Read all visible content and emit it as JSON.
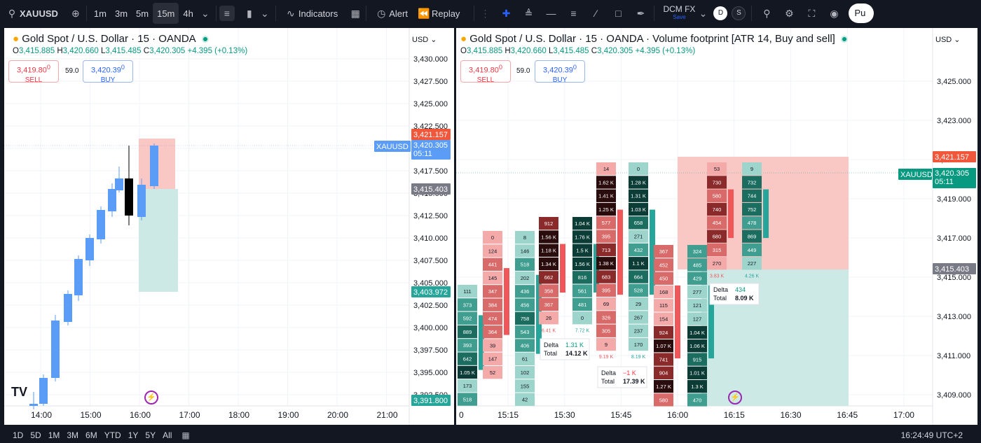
{
  "toolbar": {
    "symbol": "XAUUSD",
    "intervals": [
      "1m",
      "3m",
      "5m",
      "15m",
      "4h"
    ],
    "active_interval": "15m",
    "indicators": "Indicators",
    "alert": "Alert",
    "replay": "Replay",
    "broker": "DCM FX",
    "broker_sub": "Save",
    "avatars": [
      "D",
      "S"
    ],
    "publish": "Pu",
    "icons": [
      "search-icon",
      "plus-circle-icon",
      "bar-style-icon",
      "candles-icon",
      "chevron-down-icon",
      "indicators-icon",
      "layout-icon",
      "alert-clock-icon",
      "replay-icon",
      "crosshair-icon",
      "trend-lines-icon",
      "fib-icon",
      "pattern-icon",
      "brush-icon",
      "shape-icon",
      "text-icon",
      "magnifier-icon",
      "settings-icon",
      "fullscreen-icon",
      "camera-icon"
    ]
  },
  "left": {
    "title": "Gold Spot / U.S. Dollar · 15 · OANDA",
    "ohlc": {
      "o_label": "O",
      "o": "3,415.885",
      "h_label": "H",
      "h": "3,420.660",
      "l_label": "L",
      "l": "3,415.485",
      "c_label": "C",
      "c": "3,420.305",
      "chg": "+4.395 (+0.13%)"
    },
    "sell_price": "3,419.80",
    "sell_sup": "0",
    "sell_label": "SELL",
    "spread": "59.0",
    "buy_price": "3,420.39",
    "buy_sup": "0",
    "buy_label": "BUY",
    "currency": "USD",
    "y_ticks": [
      "3,430.000",
      "3,427.500",
      "3,425.000",
      "3,422.500",
      "3,420.000",
      "3,417.500",
      "3,415.000",
      "3,412.500",
      "3,410.000",
      "3,407.500",
      "3,405.000",
      "3,402.500",
      "3,400.000",
      "3,397.500",
      "3,395.000",
      "3,392.500"
    ],
    "x_ticks": [
      "14:00",
      "15:00",
      "16:00",
      "17:00",
      "18:00",
      "19:00",
      "20:00",
      "21:00"
    ],
    "tags": {
      "target": "3,421.157",
      "symbol": "XAUUSD",
      "last": "3,420.305",
      "countdown": "05:11",
      "entry": "3,415.403",
      "stop": "3,403.972",
      "low": "3,391.800"
    }
  },
  "right": {
    "title": "Gold Spot / U.S. Dollar · 15 · OANDA · Volume footprint [ATR 14, Buy and sell]",
    "ohlc": {
      "o_label": "O",
      "o": "3,415.885",
      "h_label": "H",
      "h": "3,420.660",
      "l_label": "L",
      "l": "3,415.485",
      "c_label": "C",
      "c": "3,420.305",
      "chg": "+4.395 (+0.13%)"
    },
    "sell_price": "3,419.80",
    "sell_sup": "0",
    "sell_label": "SELL",
    "spread": "59.0",
    "buy_price": "3,420.39",
    "buy_sup": "0",
    "buy_label": "BUY",
    "currency": "USD",
    "y_ticks": [
      "3,425.000",
      "3,423.000",
      "3,421.000",
      "3,419.000",
      "3,417.000",
      "3,415.000",
      "3,413.000",
      "3,411.000",
      "3,409.000"
    ],
    "x_ticks": [
      "0",
      "15:15",
      "15:30",
      "15:45",
      "16:00",
      "16:15",
      "16:30",
      "16:45",
      "17:00"
    ],
    "tags": {
      "target": "3,421.157",
      "symbol": "XAUUSD",
      "last": "3,420.305",
      "countdown": "05:11",
      "entry": "3,415.403"
    },
    "footprint": [
      {
        "sell": [
          null,
          null,
          null,
          null,
          null,
          "111",
          "373",
          "592",
          "889",
          "393",
          "642",
          "1.05 K",
          "173",
          "518"
        ],
        "buy": []
      },
      {
        "sell": [],
        "buy": [
          "0",
          "124",
          "441",
          "145",
          "347",
          "384",
          "474",
          "364",
          "39",
          "147",
          "52"
        ]
      },
      {
        "sell": [
          "8",
          "146",
          "518",
          "202",
          "436",
          "456",
          "758",
          "543",
          "406",
          "61",
          "102",
          "155",
          "42"
        ],
        "buy": []
      },
      {
        "sell": [
          "912",
          "1.56 K",
          "1.18 K",
          "1.34 K",
          "662",
          "358",
          "367",
          "26"
        ],
        "buy": [],
        "sub": "6.41 K"
      },
      {
        "sell": [
          "1.04 K",
          "1.76 K",
          "1.5 K",
          "1.56 K",
          "816",
          "561",
          "481",
          "0"
        ],
        "buy": [],
        "sub": "7.72 K"
      },
      {
        "sell": [
          "14",
          "1.62 K",
          "1.41 K",
          "1.25 K",
          "577",
          "395",
          "713",
          "1.38 K",
          "683",
          "395",
          "69",
          "326",
          "305",
          "9"
        ],
        "buy": [],
        "sub": "9.19 K"
      },
      {
        "sell": [
          "0",
          "1.28 K",
          "1.31 K",
          "1.03 K",
          "658",
          "271",
          "432",
          "1.1 K",
          "664",
          "528",
          "29",
          "267",
          "237",
          "170"
        ],
        "buy": [],
        "sub": "8.19 K"
      },
      {
        "sell": [
          "367",
          "452",
          "450",
          "168",
          "115",
          "154",
          "924",
          "1.07 K",
          "741",
          "904",
          "1.27 K",
          "580"
        ],
        "buy": []
      },
      {
        "sell": [
          "324",
          "485",
          "429",
          "277",
          "121",
          "127",
          "1.04 K",
          "1.06 K",
          "915",
          "1.01 K",
          "1.3 K",
          "470"
        ],
        "buy": []
      },
      {
        "sell": [
          "53",
          "730",
          "580",
          "740",
          "454",
          "680",
          "315",
          "270"
        ],
        "buy": [],
        "sub": "3.83 K"
      },
      {
        "sell": [
          "9",
          "732",
          "744",
          "752",
          "478",
          "869",
          "449",
          "227"
        ],
        "buy": [],
        "sub": "4.26 K"
      }
    ],
    "deltas": [
      {
        "delta_label": "Delta",
        "delta": "1.31 K",
        "total_label": "Total",
        "total": "14.12 K"
      },
      {
        "delta_label": "Delta",
        "delta": "−1 K",
        "total_label": "Total",
        "total": "17.39 K"
      },
      {
        "delta_label": "Delta",
        "delta": "434",
        "total_label": "Total",
        "total": "8.09 K"
      }
    ]
  },
  "bottom": {
    "ranges": [
      "1D",
      "5D",
      "1M",
      "3M",
      "6M",
      "YTD",
      "1Y",
      "5Y",
      "All"
    ],
    "clock": "16:24:49 UTC+2"
  },
  "colors": {
    "up": "#5b9cf6",
    "down": "#000000",
    "green": "#26a69a",
    "red": "#f23645",
    "target_zone": "#f9c7c4",
    "stop_zone": "#cde9e6"
  }
}
